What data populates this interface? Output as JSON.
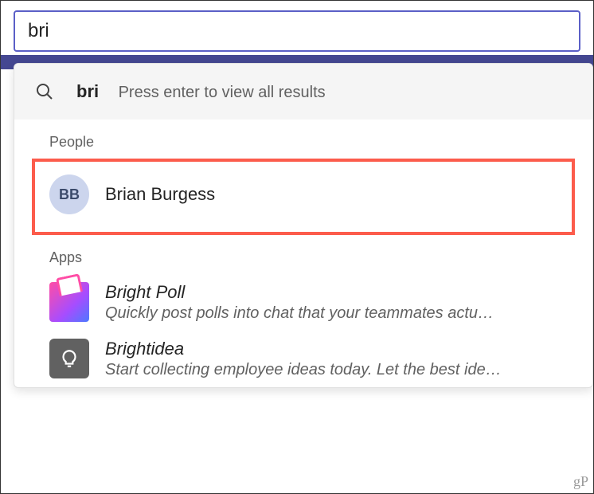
{
  "search": {
    "query": "bri",
    "hint": "Press enter to view all results"
  },
  "sections": {
    "people": {
      "header": "People",
      "items": [
        {
          "initials": "BB",
          "name": "Brian Burgess"
        }
      ]
    },
    "apps": {
      "header": "Apps",
      "items": [
        {
          "title": "Bright Poll",
          "desc": "Quickly post polls into chat that your teammates actu…"
        },
        {
          "title": "Brightidea",
          "desc": "Start collecting employee ideas today. Let the best ide…"
        }
      ]
    }
  },
  "watermark": "gP"
}
